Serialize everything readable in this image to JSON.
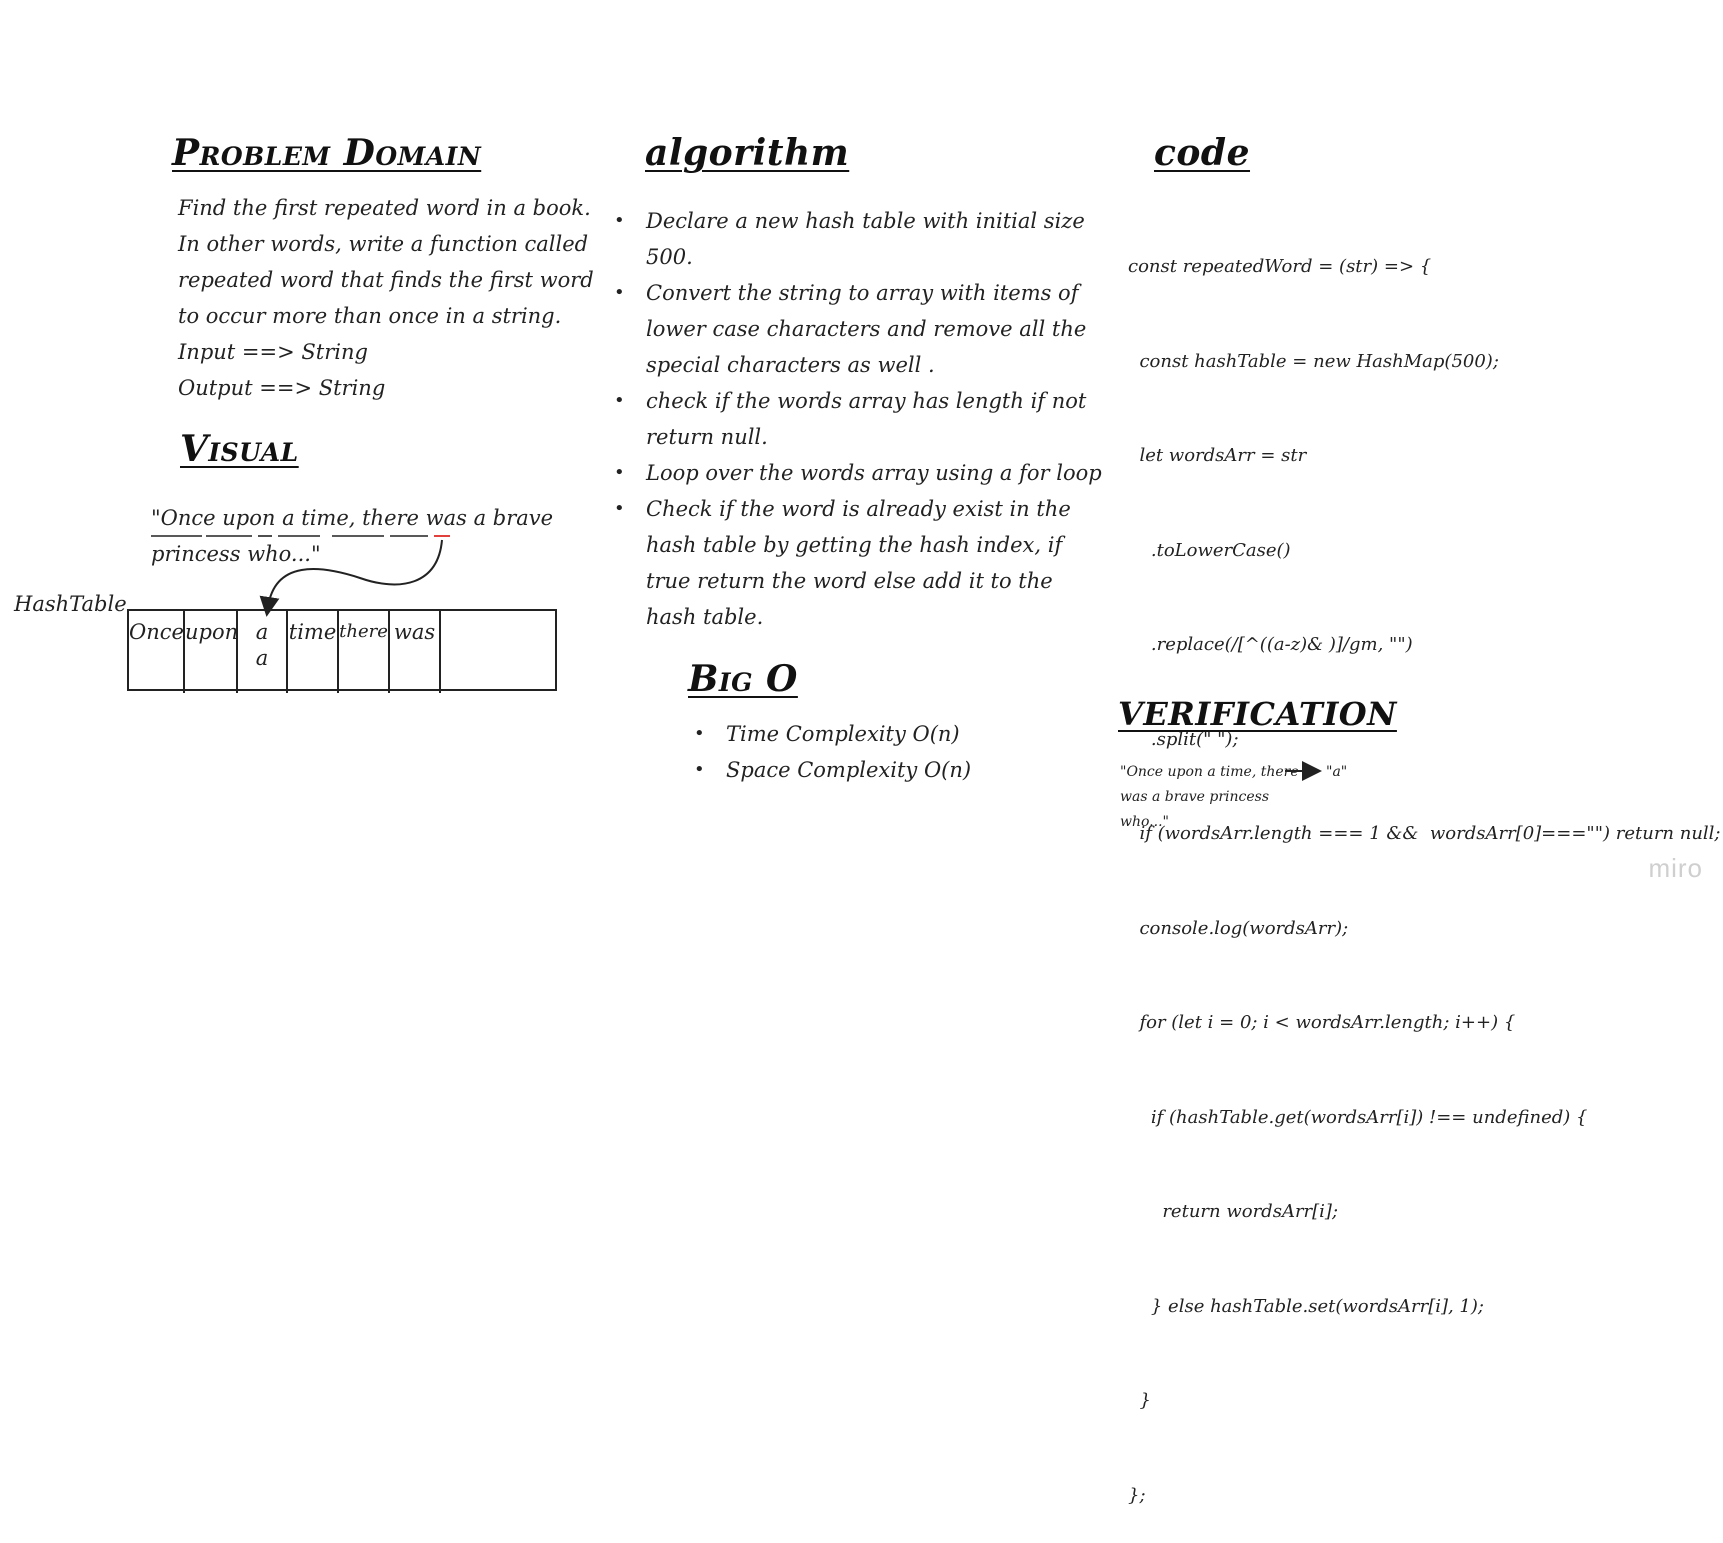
{
  "problem_domain": {
    "title": "Problem Domain",
    "lines": [
      "Find the first repeated word in a book.",
      "In other words, write a function called",
      "repeated word that finds the first word",
      "to occur more than once in a string.",
      "Input ==> String",
      "Output ==> String"
    ]
  },
  "visual": {
    "title": "Visual",
    "sentence_line1": "\"Once upon a time, there was a brave",
    "sentence_line2": "princess who...\"",
    "hashtable_label": "HashTable",
    "cells": [
      "Once",
      "upon",
      "a",
      "time",
      "there",
      "was",
      ""
    ],
    "collision": "a"
  },
  "algorithm": {
    "title": "algorithm",
    "bullet": "•",
    "items": [
      [
        "Declare a new hash table with initial size",
        "500."
      ],
      [
        "Convert the string to array with items of",
        "lower case characters and remove all the",
        "special characters as well ."
      ],
      [
        "check if the words array has length if not",
        "return null."
      ],
      [
        "Loop over the words array using a for loop"
      ],
      [
        "Check if the word is already exist in the",
        "hash table by getting the hash index, if",
        "true return the word else add it to the",
        "hash table."
      ]
    ]
  },
  "big_o": {
    "title": "Big O",
    "items": [
      "Time Complexity O(n)",
      "Space Complexity O(n)"
    ]
  },
  "code": {
    "title": "code",
    "lines": [
      "const repeatedWord = (str) => {",
      "  const hashTable = new HashMap(500);",
      "  let wordsArr = str",
      "    .toLowerCase()",
      "    .replace(/[^((a-z)& )]/gm, \"\")",
      "    .split(\" \");",
      "  if (wordsArr.length === 1 &&  wordsArr[0]===\"\") return null;",
      "  console.log(wordsArr);",
      "  for (let i = 0; i < wordsArr.length; i++) {",
      "    if (hashTable.get(wordsArr[i]) !== undefined) {",
      "      return wordsArr[i];",
      "    } else hashTable.set(wordsArr[i], 1);",
      "  }",
      "};"
    ]
  },
  "verification": {
    "title": "VERIFICATION",
    "input_lines": [
      "\"Once upon a time, there",
      "was a brave princess",
      "who...\""
    ],
    "output": "\"a\""
  },
  "watermark": "miro"
}
